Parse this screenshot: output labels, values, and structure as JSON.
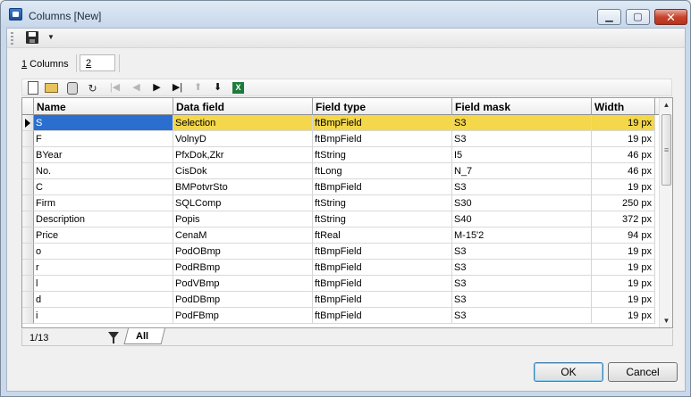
{
  "window": {
    "title": "Columns [New]"
  },
  "tabs": {
    "columns_prefix": "1",
    "columns_rest": " Columns",
    "number": "2"
  },
  "grid": {
    "columns": [
      "Name",
      "Data field",
      "Field type",
      "Field mask",
      "Width"
    ],
    "rows": [
      [
        "S",
        "Selection",
        "ftBmpField",
        "S3",
        "19 px"
      ],
      [
        "F",
        "VolnyD",
        "ftBmpField",
        "S3",
        "19 px"
      ],
      [
        "BYear",
        "PfxDok,Zkr",
        "ftString",
        "I5",
        "46 px"
      ],
      [
        "No.",
        "CisDok",
        "ftLong",
        "N_7",
        "46 px"
      ],
      [
        "C",
        "BMPotvrSto",
        "ftBmpField",
        "S3",
        "19 px"
      ],
      [
        "Firm",
        "SQLComp",
        "ftString",
        "S30",
        "250 px"
      ],
      [
        "Description",
        "Popis",
        "ftString",
        "S40",
        "372 px"
      ],
      [
        "Price",
        "CenaM",
        "ftReal",
        "M-15'2",
        "94 px"
      ],
      [
        "o",
        "PodOBmp",
        "ftBmpField",
        "S3",
        "19 px"
      ],
      [
        "r",
        "PodRBmp",
        "ftBmpField",
        "S3",
        "19 px"
      ],
      [
        "l",
        "PodVBmp",
        "ftBmpField",
        "S3",
        "19 px"
      ],
      [
        "d",
        "PodDBmp",
        "ftBmpField",
        "S3",
        "19 px"
      ],
      [
        "i",
        "PodFBmp",
        "ftBmpField",
        "S3",
        "19 px"
      ]
    ],
    "selected_row": 0
  },
  "status": {
    "record_position": "1/13",
    "filter_tab": "All"
  },
  "buttons": {
    "ok": "OK",
    "cancel": "Cancel"
  },
  "icons": {
    "toolbar": [
      "save-icon",
      "dropdown-arrow-icon"
    ],
    "nav": [
      "new-icon",
      "open-icon",
      "delete-icon",
      "refresh-icon",
      "first-icon",
      "prev-icon",
      "next-icon",
      "last-icon",
      "move-up-icon",
      "move-down-icon",
      "excel-export-icon"
    ]
  },
  "colors": {
    "selected_row": "#f4d74a",
    "selected_cell": "#2a6fd0",
    "title_bar": "#c9d8eb"
  }
}
